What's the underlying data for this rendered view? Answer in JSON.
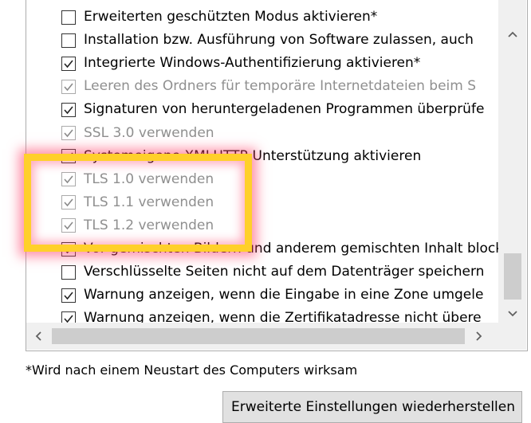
{
  "settings_list": {
    "items": [
      {
        "label": "Erweiterten geschützten Modus aktivieren*",
        "checked": false,
        "disabled": false
      },
      {
        "label": "Installation bzw. Ausführung von Software zulassen, auch",
        "checked": false,
        "disabled": false
      },
      {
        "label": "Integrierte Windows-Authentifizierung aktivieren*",
        "checked": true,
        "disabled": false
      },
      {
        "label": "Leeren des Ordners für temporäre Internetdateien beim S",
        "checked": true,
        "disabled": true
      },
      {
        "label": "Signaturen von heruntergeladenen Programmen überprüfe",
        "checked": true,
        "disabled": false
      },
      {
        "label": "SSL 3.0 verwenden",
        "checked": true,
        "disabled": true
      },
      {
        "label": "Systemeigene XMLHTTP-Unterstützung aktivieren",
        "checked": true,
        "disabled": false
      },
      {
        "label": "TLS 1.0 verwenden",
        "checked": true,
        "disabled": true
      },
      {
        "label": "TLS 1.1 verwenden",
        "checked": true,
        "disabled": true
      },
      {
        "label": "TLS 1.2 verwenden",
        "checked": true,
        "disabled": true
      },
      {
        "label": "Vor gemischten Bildern und anderem gemischten Inhalt blockie",
        "checked": true,
        "disabled": false
      },
      {
        "label": "Verschlüsselte Seiten nicht auf dem Datenträger speichern",
        "checked": false,
        "disabled": false
      },
      {
        "label": "Warnung anzeigen, wenn die Eingabe in eine Zone umgele",
        "checked": true,
        "disabled": false
      },
      {
        "label": "Warnung anzeigen, wenn die Zertifikatadresse nicht übere",
        "checked": true,
        "disabled": false
      }
    ]
  },
  "footer": {
    "restart_note": "*Wird nach einem Neustart des Computers wirksam",
    "restore_button": "Erweiterte Einstellungen wiederherstellen"
  },
  "icons": {
    "scroll_up": "chevron-up-icon",
    "scroll_down": "chevron-down-icon",
    "scroll_left": "chevron-left-icon",
    "scroll_right": "chevron-right-icon",
    "check": "checkmark-icon"
  },
  "colors": {
    "highlight_border": "#ffd02a",
    "highlight_glow": "#ff466e",
    "disabled_text": "#8f8f8f"
  }
}
